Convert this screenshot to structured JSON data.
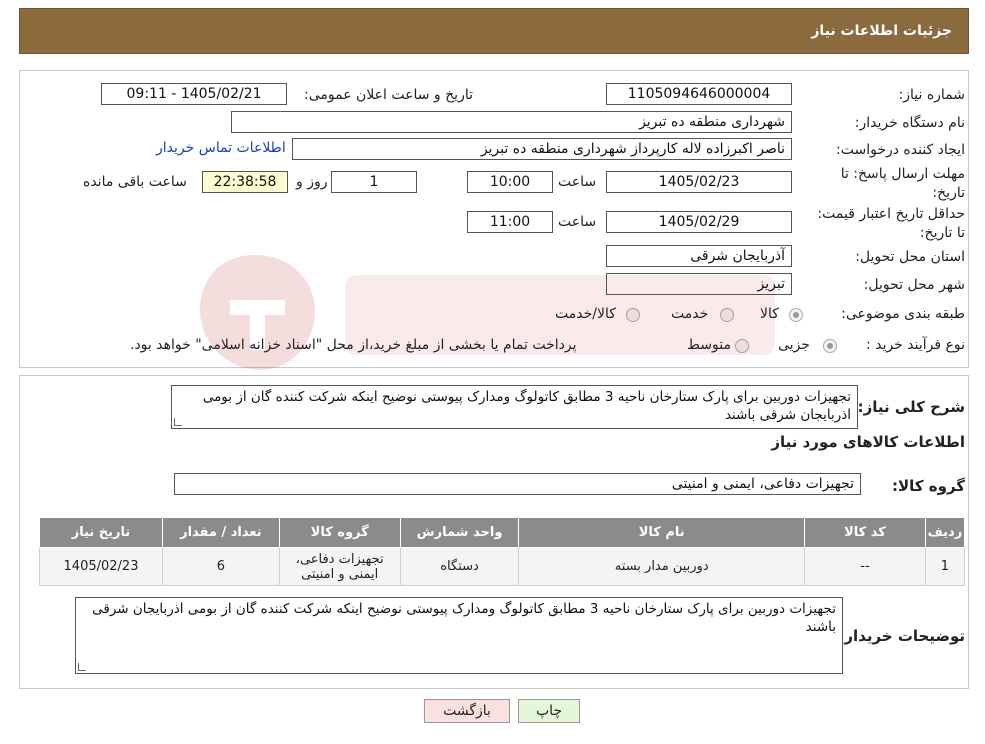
{
  "header": {
    "title": "جزئیات اطلاعات نیاز"
  },
  "form": {
    "need_number_label": "شماره نیاز:",
    "need_number": "1105094646000004",
    "announce_label": "تاریخ و ساعت اعلان عمومی:",
    "announce_value": "1405/02/21 - 09:11",
    "buyer_label": "نام دستگاه خریدار:",
    "buyer_value": "شهرداری منطقه ده تبریز",
    "creator_label": "ایجاد کننده درخواست:",
    "creator_value": "ناصر اکبرزاده لاله کارپرداز          شهرداری منطقه ده تبریز",
    "contact_link": "اطلاعات تماس خریدار",
    "deadline_label": "مهلت ارسال پاسخ: تا تاریخ:",
    "deadline_date": "1405/02/23",
    "time_label": "ساعت",
    "deadline_time": "10:00",
    "days_value": "1",
    "days_label": "روز و",
    "remaining_value": "22:38:58",
    "remaining_label": "ساعت باقی مانده",
    "validity_label": "حداقل تاریخ اعتبار قیمت: تا تاریخ:",
    "validity_date": "1405/02/29",
    "validity_time": "11:00",
    "province_label": "استان محل تحویل:",
    "province_value": "آذربایجان شرقی",
    "city_label": "شهر محل تحویل:",
    "city_value": "تبریز",
    "category_label": "طبقه بندی موضوعی:",
    "category_options": [
      "کالا",
      "خدمت",
      "کالا/خدمت"
    ],
    "process_label": "نوع فرآیند خرید :",
    "process_options": [
      "جزیی",
      "متوسط"
    ],
    "process_note": "پرداخت تمام یا بخشی از مبلغ خرید،از محل \"اسناد خزانه اسلامی\" خواهد بود."
  },
  "summary": {
    "desc_label": "شرح کلی نیاز:",
    "desc_value": "تجهیزات دوربین  برای پارک ستارخان ناحیه 3 مطابق کاتولوگ  ومدارک پیوستی نوضیح اینکه شرکت کننده گان از بومی اذربایجان شرقی باشند",
    "goods_info_title": "اطلاعات کالاهای مورد نیاز",
    "group_label": "گروه کالا:",
    "group_value": "تجهیزات دفاعی، ایمنی و امنیتی"
  },
  "table": {
    "headers": [
      "ردیف",
      "کد کالا",
      "نام کالا",
      "واحد شمارش",
      "گروه کالا",
      "تعداد / مقدار",
      "تاریخ نیاز"
    ],
    "row": [
      "1",
      "--",
      "دوربین مدار بسته",
      "دستگاه",
      "تجهیزات دفاعی، ایمنی و امنیتی",
      "6",
      "1405/02/23"
    ]
  },
  "buyer_notes": {
    "label": "توضیحات خریدار:",
    "value": "تجهیزات دوربین  برای پارک ستارخان ناحیه 3 مطابق کاتولوگ  ومدارک پیوستی نوضیح اینکه شرکت کننده گان از بومی اذربایجان شرقی باشند"
  },
  "buttons": {
    "print": "چاپ",
    "back": "بازگشت"
  },
  "colors": {
    "header": "#8b6b3e",
    "table_header": "#8b8b8b",
    "print_btn": "#e4f7d9",
    "back_btn": "#fbe0e0"
  }
}
